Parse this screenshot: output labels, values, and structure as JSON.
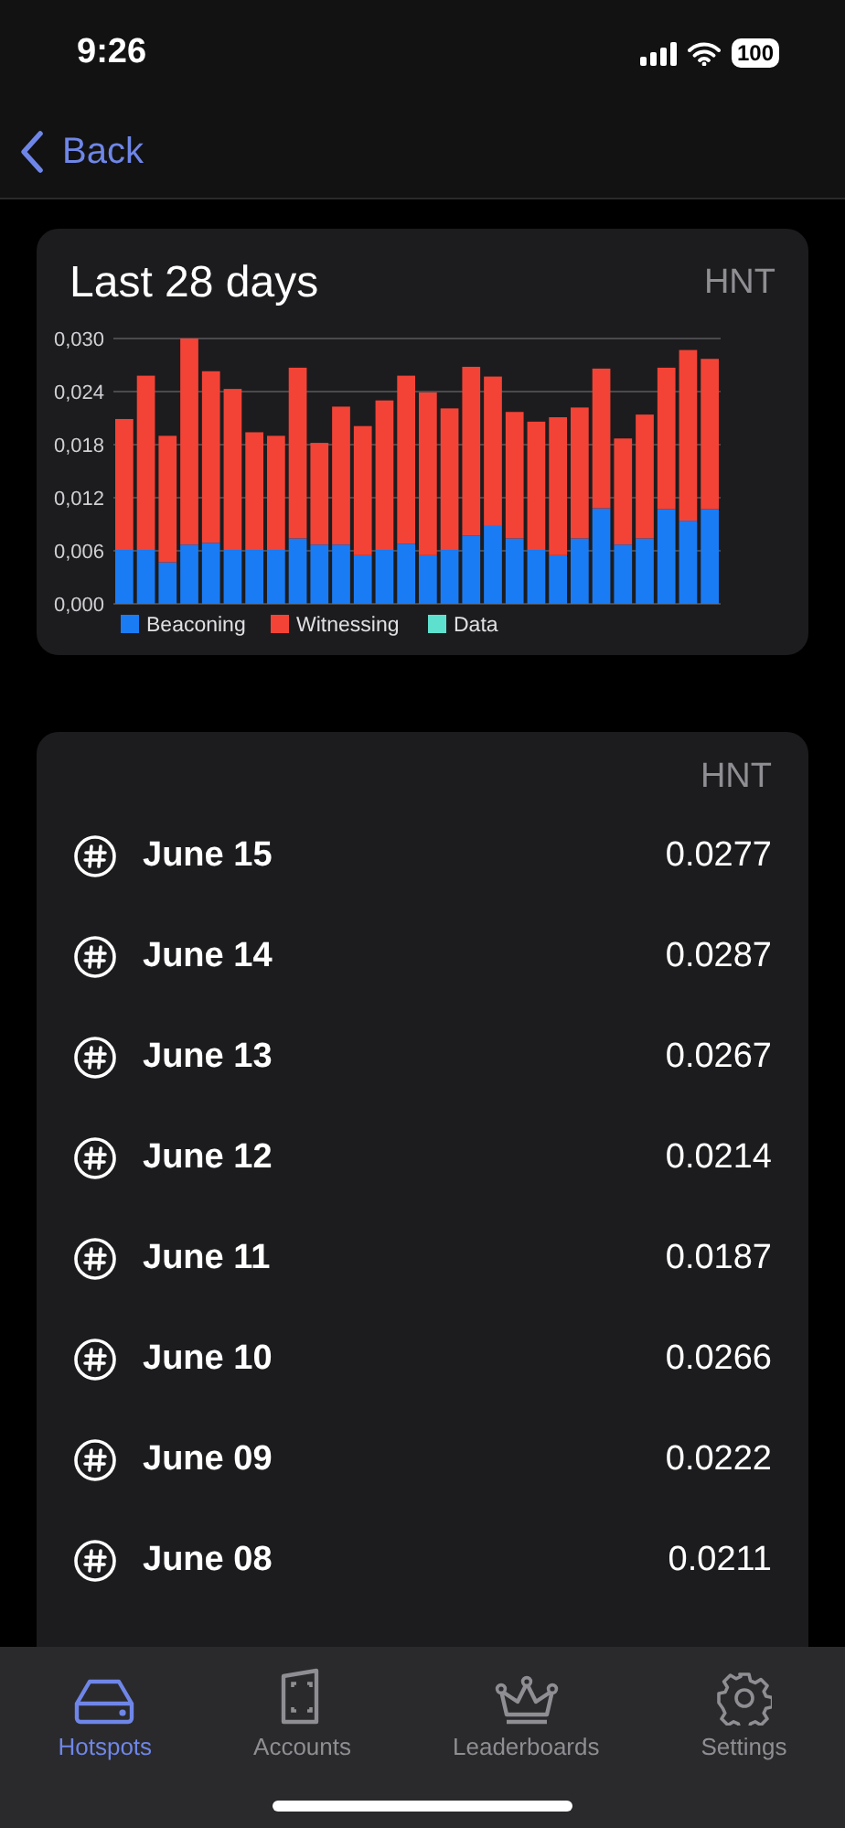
{
  "status_bar": {
    "time": "9:26",
    "battery": "100"
  },
  "nav": {
    "back_label": "Back"
  },
  "chart_card": {
    "title": "Last 28 days",
    "unit": "HNT",
    "chart_data": {
      "type": "bar",
      "stacked": true,
      "grid": true,
      "legend": true,
      "ylim": [
        0,
        0.03
      ],
      "yticks": [
        {
          "value": 0,
          "label": "0,000"
        },
        {
          "value": 0.006,
          "label": "0,006"
        },
        {
          "value": 0.012,
          "label": "0,012"
        },
        {
          "value": 0.018,
          "label": "0,018"
        },
        {
          "value": 0.024,
          "label": "0,024"
        },
        {
          "value": 0.03,
          "label": "0,030"
        }
      ],
      "series": [
        {
          "name": "Beaconing",
          "color": "#1a7cf5",
          "values": [
            0.0061,
            0.0061,
            0.0047,
            0.0067,
            0.0069,
            0.0061,
            0.0061,
            0.0061,
            0.0074,
            0.0067,
            0.0067,
            0.0055,
            0.0061,
            0.0068,
            0.0055,
            0.0061,
            0.0077,
            0.0088,
            0.0074,
            0.0061,
            0.0055,
            0.0074,
            0.0108,
            0.0067,
            0.0074,
            0.0107,
            0.0094,
            0.0107
          ]
        },
        {
          "name": "Witnessing",
          "color": "#f34336",
          "values": [
            0.0148,
            0.0197,
            0.0143,
            0.0233,
            0.0194,
            0.0182,
            0.0133,
            0.0129,
            0.0193,
            0.0115,
            0.0156,
            0.0146,
            0.0169,
            0.019,
            0.0184,
            0.016,
            0.0191,
            0.0169,
            0.0143,
            0.0145,
            0.0156,
            0.0148,
            0.0158,
            0.012,
            0.014,
            0.016,
            0.0193,
            0.017
          ]
        },
        {
          "name": "Data",
          "color": "#5ee0cf",
          "values": [
            0,
            0,
            0,
            0,
            0,
            0,
            0,
            0,
            0,
            0,
            0,
            0,
            0,
            0,
            0,
            0,
            0,
            0,
            0,
            0,
            0,
            0,
            0,
            0,
            0,
            0,
            0,
            0
          ]
        }
      ]
    }
  },
  "rewards_list": {
    "unit": "HNT",
    "rows": [
      {
        "date": "June 15",
        "amount": "0.0277"
      },
      {
        "date": "June 14",
        "amount": "0.0287"
      },
      {
        "date": "June 13",
        "amount": "0.0267"
      },
      {
        "date": "June 12",
        "amount": "0.0214"
      },
      {
        "date": "June 11",
        "amount": "0.0187"
      },
      {
        "date": "June 10",
        "amount": "0.0266"
      },
      {
        "date": "June 09",
        "amount": "0.0222"
      },
      {
        "date": "June 08",
        "amount": "0.0211"
      }
    ]
  },
  "tab_bar": [
    {
      "label": "Hotspots",
      "kind": "hotspot",
      "selected": true
    },
    {
      "label": "Accounts",
      "kind": "wallet",
      "selected": false
    },
    {
      "label": "Leaderboards",
      "kind": "crown",
      "selected": false
    },
    {
      "label": "Settings",
      "kind": "gear",
      "selected": false
    }
  ]
}
